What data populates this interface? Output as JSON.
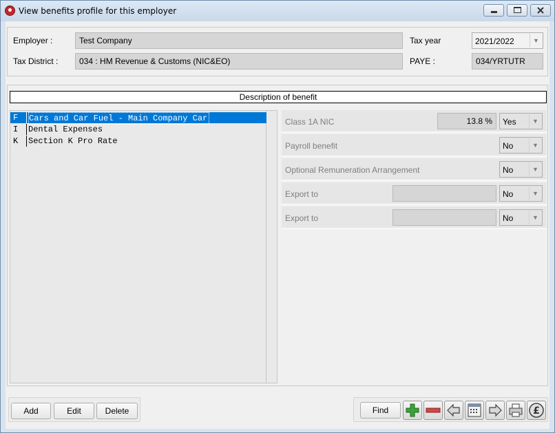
{
  "window": {
    "title": "View benefits profile for this employer"
  },
  "employer": {
    "employer_label": "Employer :",
    "employer_value": "Test Company",
    "tax_district_label": "Tax District :",
    "tax_district_value": "034 : HM Revenue & Customs (NIC&EO)",
    "tax_year_label": "Tax year",
    "tax_year_value": "2021/2022",
    "paye_label": "PAYE :",
    "paye_value": "034/YRTUTR"
  },
  "benefits": {
    "header": "Description of benefit",
    "items": [
      {
        "code": "F",
        "name": "Cars and Car Fuel - Main Company Car",
        "selected": true
      },
      {
        "code": "I",
        "name": "Dental Expenses",
        "selected": false
      },
      {
        "code": "K",
        "name": "Section K Pro Rate",
        "selected": false
      }
    ]
  },
  "properties": {
    "class1a": {
      "label": "Class 1A NIC",
      "rate": "13.8 %",
      "value": "Yes"
    },
    "payroll": {
      "label": "Payroll benefit",
      "value": "No"
    },
    "optional": {
      "label": "Optional Remuneration Arrangement",
      "value": "No"
    },
    "export1": {
      "label": "Export to",
      "field": "",
      "value": "No"
    },
    "export2": {
      "label": "Export to",
      "field": "",
      "value": "No"
    }
  },
  "buttons": {
    "add": "Add",
    "edit": "Edit",
    "delete": "Delete",
    "find": "Find"
  },
  "toolbar_icons": [
    "add-record-icon",
    "remove-record-icon",
    "previous-icon",
    "calendar-icon",
    "next-icon",
    "print-icon",
    "pound-icon"
  ],
  "colors": {
    "selection": "#0078d7",
    "add_icon": "#3aa33a",
    "remove_icon": "#d04848"
  }
}
